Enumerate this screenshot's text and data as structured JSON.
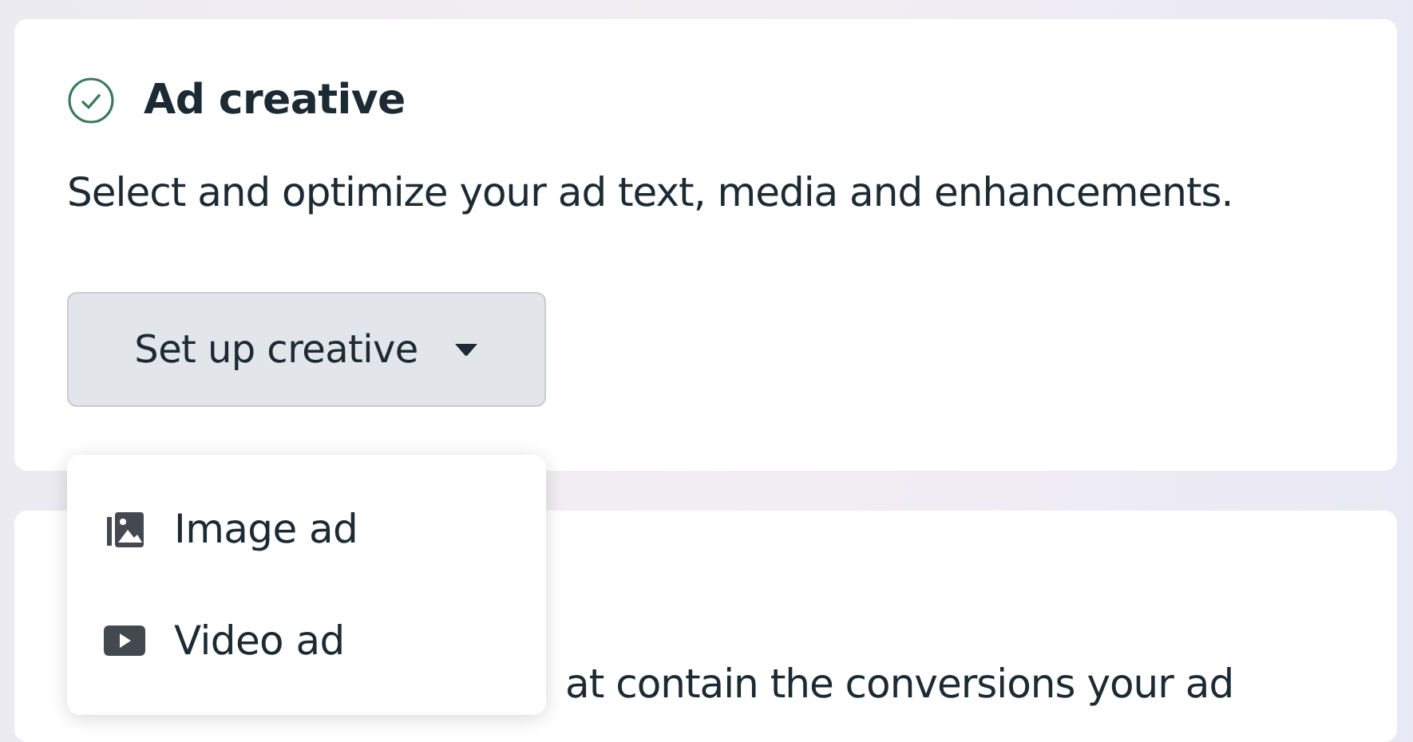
{
  "creative_card": {
    "title": "Ad creative",
    "complete": true,
    "description": "Select and optimize your ad text, media and enhancements.",
    "setup_button": {
      "label": "Set up creative",
      "expanded": true
    }
  },
  "dropdown_menu": {
    "items": [
      {
        "kind": "image",
        "label": "Image ad"
      },
      {
        "kind": "video",
        "label": "Video ad"
      }
    ]
  },
  "dataset_card": {
    "visible_text": "at contain the conversions your ad"
  }
}
